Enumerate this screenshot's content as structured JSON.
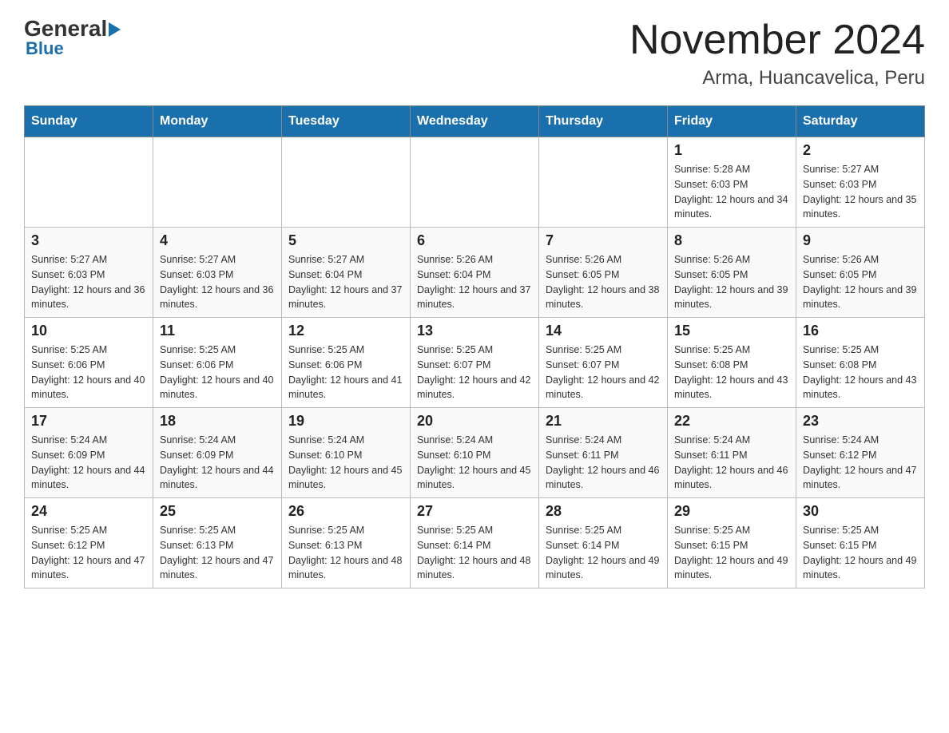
{
  "header": {
    "logo_general": "General",
    "logo_blue": "Blue",
    "month_title": "November 2024",
    "location": "Arma, Huancavelica, Peru"
  },
  "weekdays": [
    "Sunday",
    "Monday",
    "Tuesday",
    "Wednesday",
    "Thursday",
    "Friday",
    "Saturday"
  ],
  "weeks": [
    [
      {
        "day": "",
        "sunrise": "",
        "sunset": "",
        "daylight": ""
      },
      {
        "day": "",
        "sunrise": "",
        "sunset": "",
        "daylight": ""
      },
      {
        "day": "",
        "sunrise": "",
        "sunset": "",
        "daylight": ""
      },
      {
        "day": "",
        "sunrise": "",
        "sunset": "",
        "daylight": ""
      },
      {
        "day": "",
        "sunrise": "",
        "sunset": "",
        "daylight": ""
      },
      {
        "day": "1",
        "sunrise": "Sunrise: 5:28 AM",
        "sunset": "Sunset: 6:03 PM",
        "daylight": "Daylight: 12 hours and 34 minutes."
      },
      {
        "day": "2",
        "sunrise": "Sunrise: 5:27 AM",
        "sunset": "Sunset: 6:03 PM",
        "daylight": "Daylight: 12 hours and 35 minutes."
      }
    ],
    [
      {
        "day": "3",
        "sunrise": "Sunrise: 5:27 AM",
        "sunset": "Sunset: 6:03 PM",
        "daylight": "Daylight: 12 hours and 36 minutes."
      },
      {
        "day": "4",
        "sunrise": "Sunrise: 5:27 AM",
        "sunset": "Sunset: 6:03 PM",
        "daylight": "Daylight: 12 hours and 36 minutes."
      },
      {
        "day": "5",
        "sunrise": "Sunrise: 5:27 AM",
        "sunset": "Sunset: 6:04 PM",
        "daylight": "Daylight: 12 hours and 37 minutes."
      },
      {
        "day": "6",
        "sunrise": "Sunrise: 5:26 AM",
        "sunset": "Sunset: 6:04 PM",
        "daylight": "Daylight: 12 hours and 37 minutes."
      },
      {
        "day": "7",
        "sunrise": "Sunrise: 5:26 AM",
        "sunset": "Sunset: 6:05 PM",
        "daylight": "Daylight: 12 hours and 38 minutes."
      },
      {
        "day": "8",
        "sunrise": "Sunrise: 5:26 AM",
        "sunset": "Sunset: 6:05 PM",
        "daylight": "Daylight: 12 hours and 39 minutes."
      },
      {
        "day": "9",
        "sunrise": "Sunrise: 5:26 AM",
        "sunset": "Sunset: 6:05 PM",
        "daylight": "Daylight: 12 hours and 39 minutes."
      }
    ],
    [
      {
        "day": "10",
        "sunrise": "Sunrise: 5:25 AM",
        "sunset": "Sunset: 6:06 PM",
        "daylight": "Daylight: 12 hours and 40 minutes."
      },
      {
        "day": "11",
        "sunrise": "Sunrise: 5:25 AM",
        "sunset": "Sunset: 6:06 PM",
        "daylight": "Daylight: 12 hours and 40 minutes."
      },
      {
        "day": "12",
        "sunrise": "Sunrise: 5:25 AM",
        "sunset": "Sunset: 6:06 PM",
        "daylight": "Daylight: 12 hours and 41 minutes."
      },
      {
        "day": "13",
        "sunrise": "Sunrise: 5:25 AM",
        "sunset": "Sunset: 6:07 PM",
        "daylight": "Daylight: 12 hours and 42 minutes."
      },
      {
        "day": "14",
        "sunrise": "Sunrise: 5:25 AM",
        "sunset": "Sunset: 6:07 PM",
        "daylight": "Daylight: 12 hours and 42 minutes."
      },
      {
        "day": "15",
        "sunrise": "Sunrise: 5:25 AM",
        "sunset": "Sunset: 6:08 PM",
        "daylight": "Daylight: 12 hours and 43 minutes."
      },
      {
        "day": "16",
        "sunrise": "Sunrise: 5:25 AM",
        "sunset": "Sunset: 6:08 PM",
        "daylight": "Daylight: 12 hours and 43 minutes."
      }
    ],
    [
      {
        "day": "17",
        "sunrise": "Sunrise: 5:24 AM",
        "sunset": "Sunset: 6:09 PM",
        "daylight": "Daylight: 12 hours and 44 minutes."
      },
      {
        "day": "18",
        "sunrise": "Sunrise: 5:24 AM",
        "sunset": "Sunset: 6:09 PM",
        "daylight": "Daylight: 12 hours and 44 minutes."
      },
      {
        "day": "19",
        "sunrise": "Sunrise: 5:24 AM",
        "sunset": "Sunset: 6:10 PM",
        "daylight": "Daylight: 12 hours and 45 minutes."
      },
      {
        "day": "20",
        "sunrise": "Sunrise: 5:24 AM",
        "sunset": "Sunset: 6:10 PM",
        "daylight": "Daylight: 12 hours and 45 minutes."
      },
      {
        "day": "21",
        "sunrise": "Sunrise: 5:24 AM",
        "sunset": "Sunset: 6:11 PM",
        "daylight": "Daylight: 12 hours and 46 minutes."
      },
      {
        "day": "22",
        "sunrise": "Sunrise: 5:24 AM",
        "sunset": "Sunset: 6:11 PM",
        "daylight": "Daylight: 12 hours and 46 minutes."
      },
      {
        "day": "23",
        "sunrise": "Sunrise: 5:24 AM",
        "sunset": "Sunset: 6:12 PM",
        "daylight": "Daylight: 12 hours and 47 minutes."
      }
    ],
    [
      {
        "day": "24",
        "sunrise": "Sunrise: 5:25 AM",
        "sunset": "Sunset: 6:12 PM",
        "daylight": "Daylight: 12 hours and 47 minutes."
      },
      {
        "day": "25",
        "sunrise": "Sunrise: 5:25 AM",
        "sunset": "Sunset: 6:13 PM",
        "daylight": "Daylight: 12 hours and 47 minutes."
      },
      {
        "day": "26",
        "sunrise": "Sunrise: 5:25 AM",
        "sunset": "Sunset: 6:13 PM",
        "daylight": "Daylight: 12 hours and 48 minutes."
      },
      {
        "day": "27",
        "sunrise": "Sunrise: 5:25 AM",
        "sunset": "Sunset: 6:14 PM",
        "daylight": "Daylight: 12 hours and 48 minutes."
      },
      {
        "day": "28",
        "sunrise": "Sunrise: 5:25 AM",
        "sunset": "Sunset: 6:14 PM",
        "daylight": "Daylight: 12 hours and 49 minutes."
      },
      {
        "day": "29",
        "sunrise": "Sunrise: 5:25 AM",
        "sunset": "Sunset: 6:15 PM",
        "daylight": "Daylight: 12 hours and 49 minutes."
      },
      {
        "day": "30",
        "sunrise": "Sunrise: 5:25 AM",
        "sunset": "Sunset: 6:15 PM",
        "daylight": "Daylight: 12 hours and 49 minutes."
      }
    ]
  ]
}
